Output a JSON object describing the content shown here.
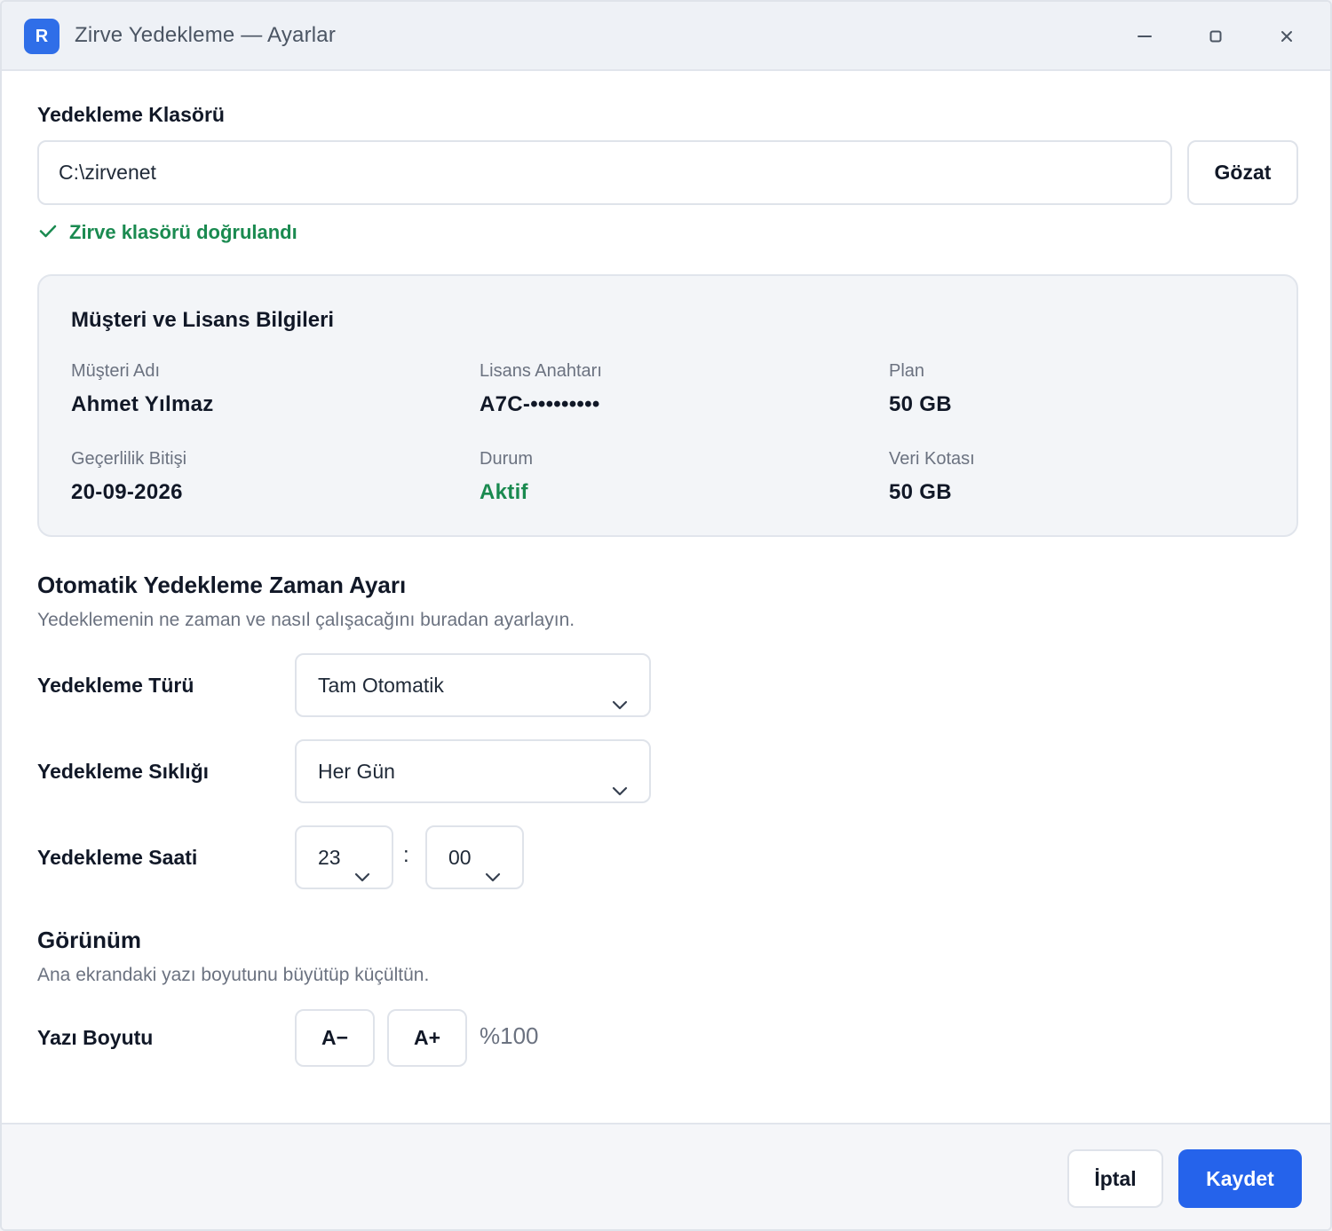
{
  "window": {
    "logo_letter": "R",
    "title": "Zirve Yedekleme — Ayarlar"
  },
  "backup_folder": {
    "label": "Yedekleme Klasörü",
    "path": "C:\\zirvenet",
    "browse_label": "Gözat",
    "verified_text": "Zirve klasörü doğrulandı"
  },
  "license_card": {
    "title": "Müşteri ve Lisans Bilgileri",
    "fields": [
      {
        "label": "Müşteri Adı",
        "value": "Ahmet Yılmaz"
      },
      {
        "label": "Lisans Anahtarı",
        "value": "A7C-•••••••••"
      },
      {
        "label": "Plan",
        "value": "50 GB"
      },
      {
        "label": "Geçerlilik Bitişi",
        "value": "20-09-2026"
      },
      {
        "label": "Durum",
        "value": "Aktif"
      },
      {
        "label": "Veri Kotası",
        "value": "50 GB"
      }
    ]
  },
  "schedule": {
    "title": "Otomatik Yedekleme Zaman Ayarı",
    "subtitle": "Yedeklemenin ne zaman ve nasıl çalışacağını buradan ayarlayın.",
    "type_label": "Yedekleme Türü",
    "type_value": "Tam Otomatik",
    "frequency_label": "Yedekleme Sıklığı",
    "frequency_value": "Her Gün",
    "time_label": "Yedekleme Saati",
    "hour": "23",
    "separator": ":",
    "minute": "00"
  },
  "appearance": {
    "title": "Görünüm",
    "subtitle": "Ana ekrandaki yazı boyutunu büyütüp küçültün.",
    "font_size_label": "Yazı Boyutu",
    "decrease_label": "A−",
    "increase_label": "A+",
    "font_size_value": "%100"
  },
  "footer": {
    "cancel_label": "İptal",
    "save_label": "Kaydet"
  },
  "colors": {
    "accent": "#2563eb",
    "success": "#1a8a50"
  }
}
